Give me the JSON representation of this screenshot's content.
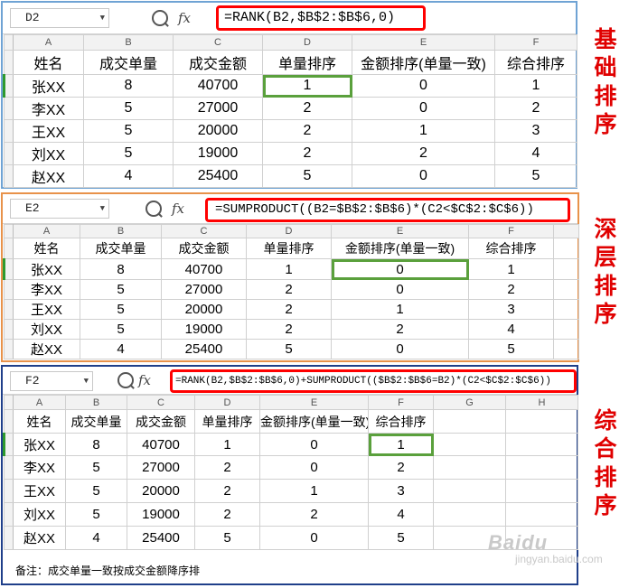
{
  "headers": [
    "姓名",
    "成交单量",
    "成交金额",
    "单量排序",
    "金额排序(单量一致)",
    "综合排序"
  ],
  "rows": [
    [
      "张XX",
      "8",
      "40700",
      "1",
      "0",
      "1"
    ],
    [
      "李XX",
      "5",
      "27000",
      "2",
      "0",
      "2"
    ],
    [
      "王XX",
      "5",
      "20000",
      "2",
      "1",
      "3"
    ],
    [
      "刘XX",
      "5",
      "19000",
      "2",
      "2",
      "4"
    ],
    [
      "赵XX",
      "4",
      "25400",
      "5",
      "0",
      "5"
    ]
  ],
  "fx_label": "fx",
  "panel1": {
    "cell_ref": "D2",
    "formula": "=RANK(B2,$B$2:$B$6,0)",
    "cols": [
      "A",
      "B",
      "C",
      "D",
      "E",
      "F"
    ],
    "side_label": [
      "基",
      "础",
      "排",
      "序"
    ]
  },
  "panel2": {
    "cell_ref": "E2",
    "formula": "=SUMPRODUCT((B2=$B$2:$B$6)*(C2<$C$2:$C$6))",
    "cols": [
      "A",
      "B",
      "C",
      "D",
      "E",
      "F"
    ],
    "side_label": [
      "深",
      "层",
      "排",
      "序"
    ]
  },
  "panel3": {
    "cell_ref": "F2",
    "formula": "=RANK(B2,$B$2:$B$6,0)+SUMPRODUCT(($B$2:$B$6=B2)*(C2<$C$2:$C$6))",
    "cols": [
      "A",
      "B",
      "C",
      "D",
      "E",
      "F",
      "G",
      "H"
    ],
    "side_label": [
      "综",
      "合",
      "排",
      "序"
    ],
    "note": "备注：成交单量一致按成交金额降序排"
  },
  "watermark": {
    "brand": "Baidu",
    "sub": "jingyan.baidu.com"
  },
  "colors": {
    "formula_border": "#ff0000",
    "side_label": "#e00000",
    "selection": "#5aa03c",
    "panel1_border": "#6fa3d4",
    "panel2_border": "#e8924a",
    "panel3_border": "#1f3f8a"
  }
}
